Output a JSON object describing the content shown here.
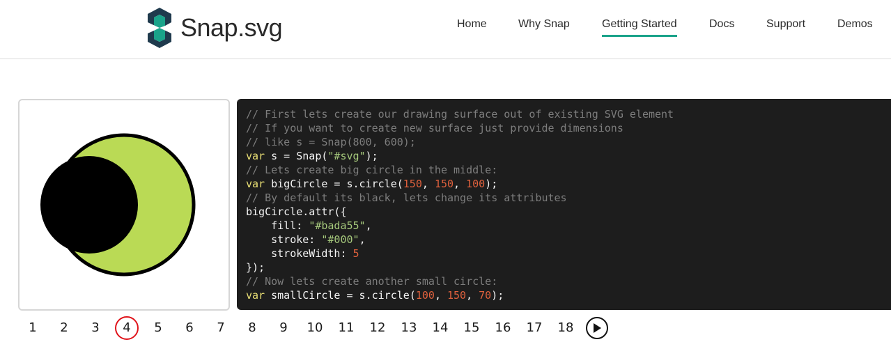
{
  "brand": {
    "name": "Snap.svg",
    "colors": {
      "dark": "#1f3a4d",
      "green": "#1aa38a"
    }
  },
  "nav": {
    "items": [
      {
        "label": "Home",
        "active": false
      },
      {
        "label": "Why Snap",
        "active": false
      },
      {
        "label": "Getting Started",
        "active": true
      },
      {
        "label": "Docs",
        "active": false
      },
      {
        "label": "Support",
        "active": false
      },
      {
        "label": "Demos",
        "active": false
      }
    ],
    "accent": "#1aa38a"
  },
  "demo": {
    "big_circle": {
      "fill": "#bada55",
      "stroke": "#000000"
    },
    "small_circle": {
      "fill": "#000000"
    }
  },
  "code": {
    "lines": [
      [
        [
          "comment",
          "// First lets create our drawing surface out of existing SVG element"
        ]
      ],
      [
        [
          "comment",
          "// If you want to create new surface just provide dimensions"
        ]
      ],
      [
        [
          "comment",
          "// like s = Snap(800, 600);"
        ]
      ],
      [
        [
          "keyword",
          "var"
        ],
        [
          "plain",
          " s = Snap("
        ],
        [
          "string",
          "\"#svg\""
        ],
        [
          "plain",
          ");"
        ]
      ],
      [
        [
          "comment",
          "// Lets create big circle in the middle:"
        ]
      ],
      [
        [
          "keyword",
          "var"
        ],
        [
          "plain",
          " bigCircle = s.circle("
        ],
        [
          "number",
          "150"
        ],
        [
          "plain",
          ", "
        ],
        [
          "number",
          "150"
        ],
        [
          "plain",
          ", "
        ],
        [
          "number",
          "100"
        ],
        [
          "plain",
          ");"
        ]
      ],
      [
        [
          "comment",
          "// By default its black, lets change its attributes"
        ]
      ],
      [
        [
          "plain",
          "bigCircle.attr({"
        ]
      ],
      [
        [
          "plain",
          "    fill: "
        ],
        [
          "string",
          "\"#bada55\""
        ],
        [
          "plain",
          ","
        ]
      ],
      [
        [
          "plain",
          "    stroke: "
        ],
        [
          "string",
          "\"#000\""
        ],
        [
          "plain",
          ","
        ]
      ],
      [
        [
          "plain",
          "    strokeWidth: "
        ],
        [
          "number",
          "5"
        ]
      ],
      [
        [
          "plain",
          "});"
        ]
      ],
      [
        [
          "comment",
          "// Now lets create another small circle:"
        ]
      ],
      [
        [
          "keyword",
          "var"
        ],
        [
          "plain",
          " smallCircle = s.circle("
        ],
        [
          "number",
          "100"
        ],
        [
          "plain",
          ", "
        ],
        [
          "number",
          "150"
        ],
        [
          "plain",
          ", "
        ],
        [
          "number",
          "70"
        ],
        [
          "plain",
          ");"
        ]
      ]
    ],
    "colors": {
      "background": "#1d1d1d",
      "comment": "#7d7d7d",
      "keyword": "#e9df74",
      "string": "#a6c97c",
      "number": "#e0613d"
    }
  },
  "pager": {
    "pages": [
      "1",
      "2",
      "3",
      "4",
      "5",
      "6",
      "7",
      "8",
      "9",
      "10",
      "11",
      "12",
      "13",
      "14",
      "15",
      "16",
      "17",
      "18"
    ],
    "current": "4",
    "play_icon": "play-icon",
    "current_color": "#e0141b"
  }
}
